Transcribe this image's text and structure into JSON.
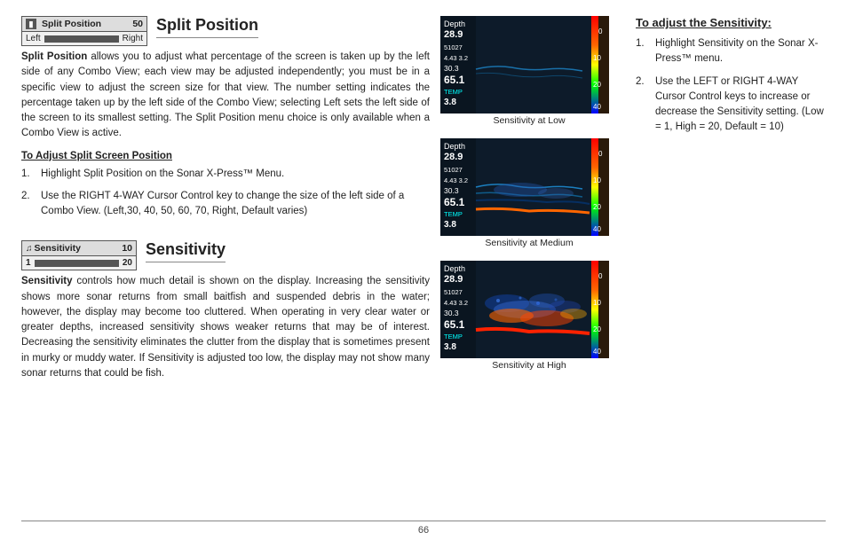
{
  "page": {
    "number": "66"
  },
  "splitPosition": {
    "title": "Split Position",
    "widgetLabel": "Split Position",
    "widgetValue": "50",
    "widgetLeftLabel": "Left",
    "widgetRightLabel": "Right",
    "bodyText": " allows you to adjust what percentage of the screen is taken up by the left side of any Combo View; each view may be adjusted independently; you must be in a specific view to adjust the screen size for that view. The number setting indicates the percentage taken up by the left side of the Combo View; selecting Left sets the left side of the screen to its smallest setting. The Split Position menu choice is only available when a Combo View is active.",
    "bodyBold": "Split Position",
    "subsectionTitle": "To Adjust Split Screen Position",
    "step1": "Highlight Split Position on the Sonar X-Press™ Menu.",
    "step2": "Use the RIGHT 4-WAY Cursor Control key to change the size of the left side of a Combo View. (Left,30, 40, 50, 60, 70, Right, Default varies)"
  },
  "sensitivity": {
    "title": "Sensitivity",
    "widgetLabel": "Sensitivity",
    "widgetValue": "10",
    "widgetLeftLabel": "1",
    "widgetRightLabel": "20",
    "bodyBold": "Sensitivity",
    "bodyText": " controls how much detail is shown on the display. Increasing the sensitivity shows more sonar returns from small baitfish and suspended debris in the water; however, the display may become too cluttered. When operating in very clear water or greater depths, increased sensitivity shows weaker returns that may be of interest. Decreasing the sensitivity eliminates the clutter from the display that is sometimes present in murky or muddy water. If Sensitivity is adjusted too low, the display may not show many sonar returns that could be fish.",
    "images": [
      {
        "label": "Sensitivity at Low"
      },
      {
        "label": "Sensitivity at Medium"
      },
      {
        "label": "Sensitivity at High"
      }
    ],
    "adjustTitle": "To adjust the Sensitivity:",
    "step1": "Highlight Sensitivity on the Sonar X-Press™ menu.",
    "step2": "Use the LEFT or RIGHT 4-WAY Cursor Control keys to increase or decrease the Sensitivity setting. (Low = 1, High = 20, Default = 10)"
  }
}
